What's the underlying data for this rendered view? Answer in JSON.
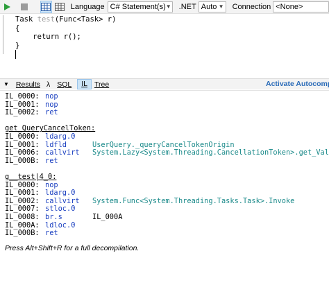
{
  "toolbar": {
    "run_icon": "play-icon",
    "stop_icon": "stop-icon",
    "grid_icon": "grid-results-icon",
    "data_grid_icon": "data-grid-icon",
    "language_label": "Language",
    "language_value": "C# Statement(s)",
    "net_label": ".NET",
    "net_value": "Auto",
    "connection_label": "Connection",
    "connection_value": "<None>",
    "colors": {
      "run": "#2e9e3c",
      "selected_bg": "#cce4f7"
    }
  },
  "editor": {
    "lines": [
      {
        "type": "Task",
        "name": "test",
        "sig": "(Func<Task> r)"
      },
      {
        "text": "{"
      },
      {
        "keyword": "return",
        "expr": "r();"
      },
      {
        "text": "}"
      }
    ]
  },
  "tabs": {
    "results": "Results",
    "lambda": "λ",
    "sql": "SQL",
    "il": "IL",
    "tree": "Tree",
    "autocomplete": "Activate Autocomple"
  },
  "output": {
    "blocks": [
      {
        "title": "",
        "rows": [
          {
            "label": "IL_0000:",
            "op": "nop",
            "arg": ""
          },
          {
            "label": "IL_0001:",
            "op": "nop",
            "arg": ""
          },
          {
            "label": "IL_0002:",
            "op": "ret",
            "arg": ""
          }
        ]
      },
      {
        "title": "get_QueryCancelToken:",
        "rows": [
          {
            "label": "IL_0000:",
            "op": "ldarg.0",
            "arg": ""
          },
          {
            "label": "IL_0001:",
            "op": "ldfld",
            "arg": "UserQuery._queryCancelTokenOrigin"
          },
          {
            "label": "IL_0006:",
            "op": "callvirt",
            "arg": "System.Lazy<System.Threading.CancellationToken>.get_Value"
          },
          {
            "label": "IL_000B:",
            "op": "ret",
            "arg": ""
          }
        ]
      },
      {
        "title": "g__test|4_0:",
        "rows": [
          {
            "label": "IL_0000:",
            "op": "nop",
            "arg": ""
          },
          {
            "label": "IL_0001:",
            "op": "ldarg.0",
            "arg": ""
          },
          {
            "label": "IL_0002:",
            "op": "callvirt",
            "arg": "System.Func<System.Threading.Tasks.Task>.Invoke"
          },
          {
            "label": "IL_0007:",
            "op": "stloc.0",
            "arg": ""
          },
          {
            "label": "IL_0008:",
            "op": "br.s",
            "arg": "IL_000A"
          },
          {
            "label": "IL_000A:",
            "op": "ldloc.0",
            "arg": ""
          },
          {
            "label": "IL_000B:",
            "op": "ret",
            "arg": ""
          }
        ]
      }
    ],
    "footer": "Press Alt+Shift+R for a full decompilation."
  }
}
